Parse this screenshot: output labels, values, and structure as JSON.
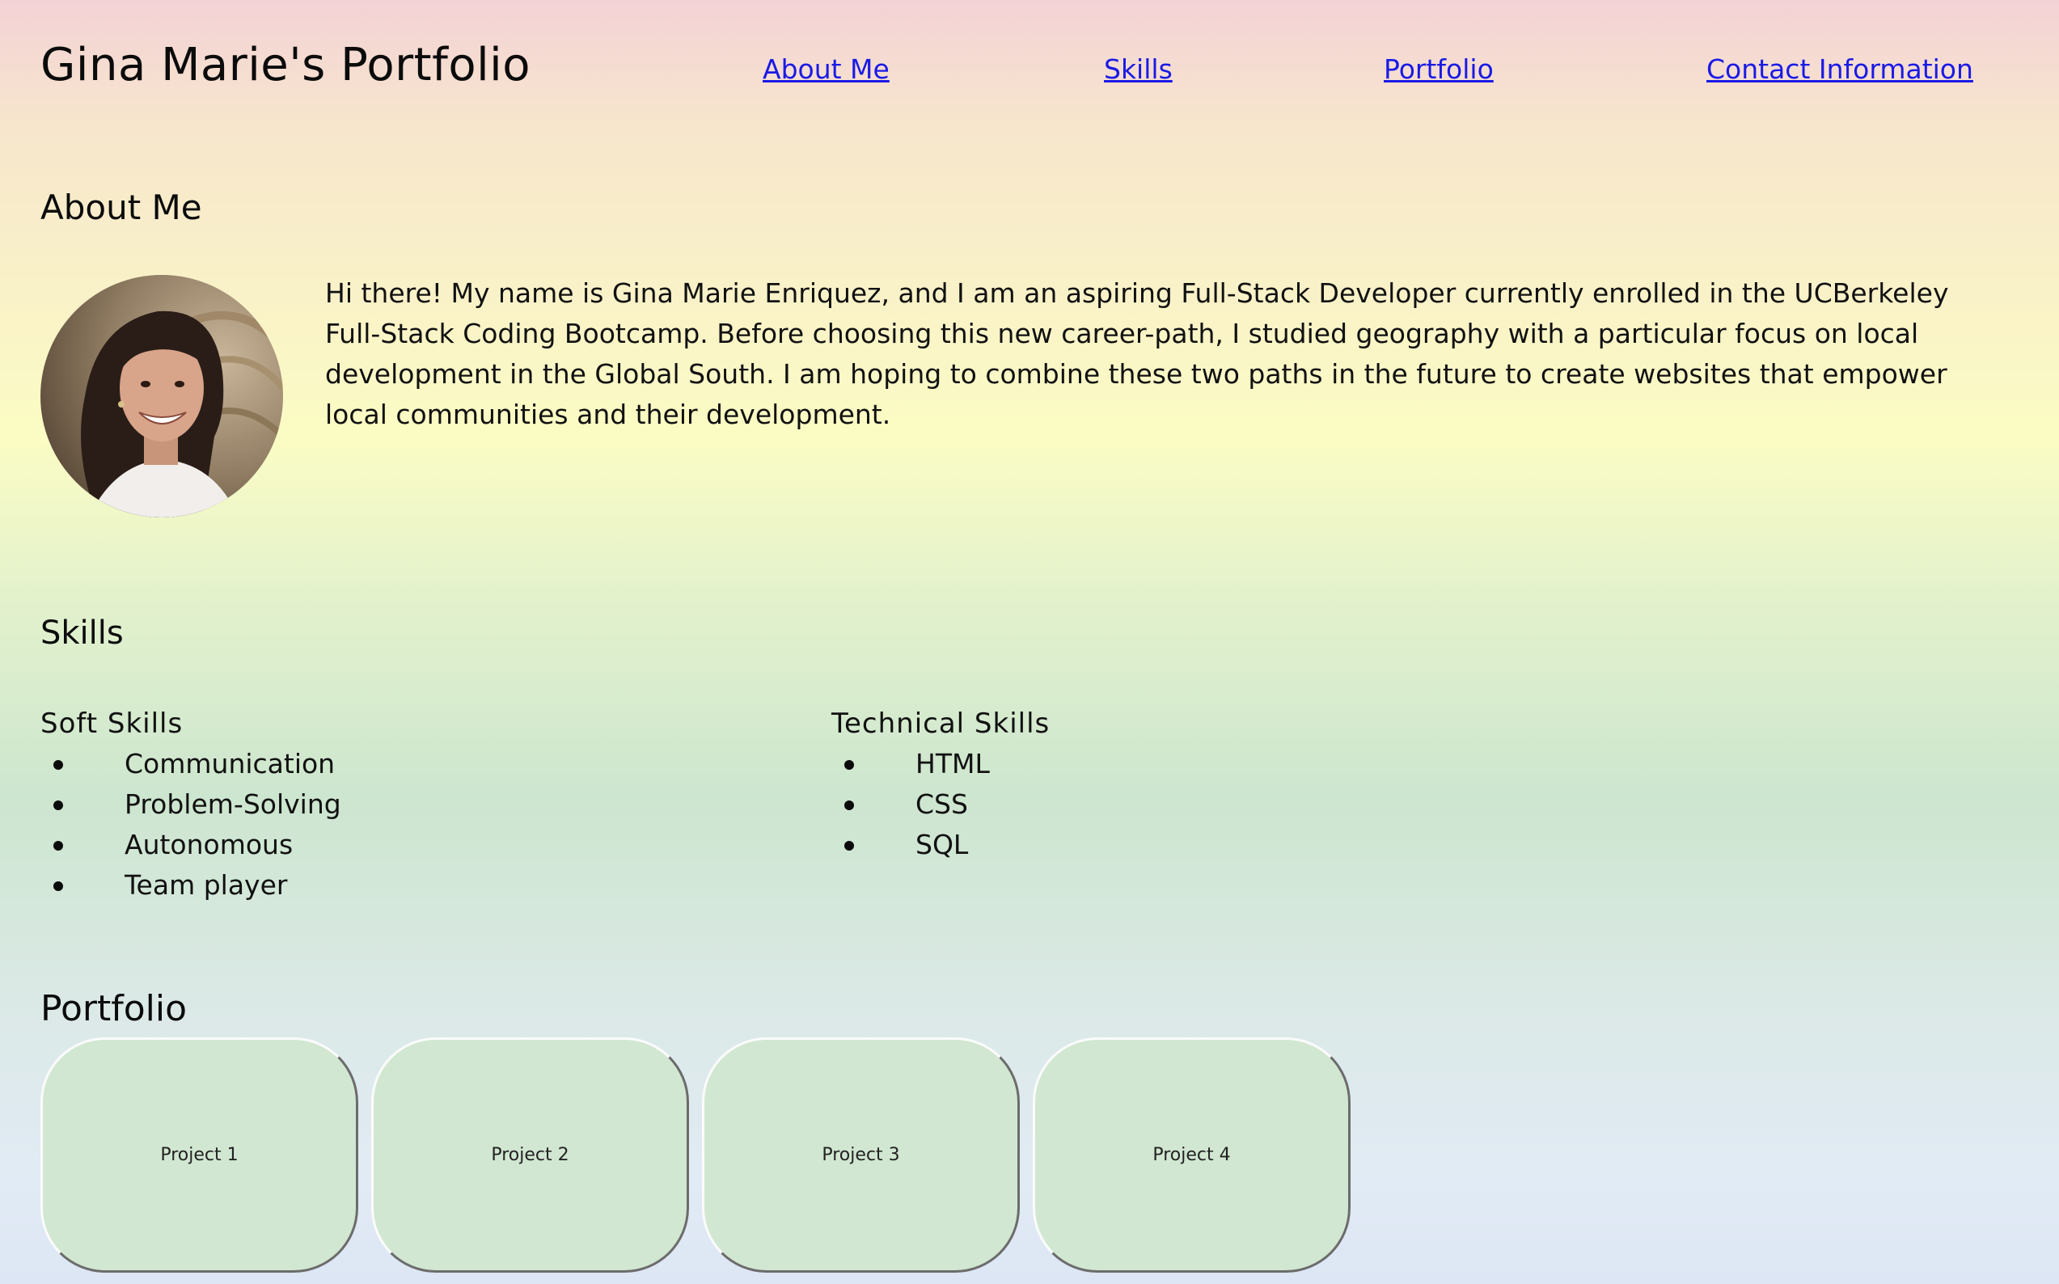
{
  "header": {
    "title": "Gina Marie's Portfolio",
    "nav": [
      {
        "label": "About Me"
      },
      {
        "label": "Skills"
      },
      {
        "label": "Portfolio"
      },
      {
        "label": "Contact Information"
      }
    ]
  },
  "about": {
    "heading": "About Me",
    "bio": "Hi there! My name is Gina Marie Enriquez, and I am an aspiring Full-Stack Developer currently enrolled in the UCBerkeley Full-Stack Coding Bootcamp. Before choosing this new career-path, I studied geography with a particular focus on local development in the Global South. I am hoping to combine these two paths in the future to create websites that empower local communities and their development."
  },
  "skills": {
    "heading": "Skills",
    "soft": {
      "title": "Soft Skills",
      "items": [
        "Communication",
        "Problem-Solving",
        "Autonomous",
        "Team player"
      ]
    },
    "technical": {
      "title": "Technical Skills",
      "items": [
        "HTML",
        "CSS",
        "SQL"
      ]
    }
  },
  "portfolio": {
    "heading": "Portfolio",
    "projects": [
      {
        "label": "Project 1"
      },
      {
        "label": "Project 2"
      },
      {
        "label": "Project 3"
      },
      {
        "label": "Project 4"
      }
    ]
  },
  "colors": {
    "link": "#1a1ae6",
    "card": "#d1e7d1",
    "text": "#111111"
  }
}
